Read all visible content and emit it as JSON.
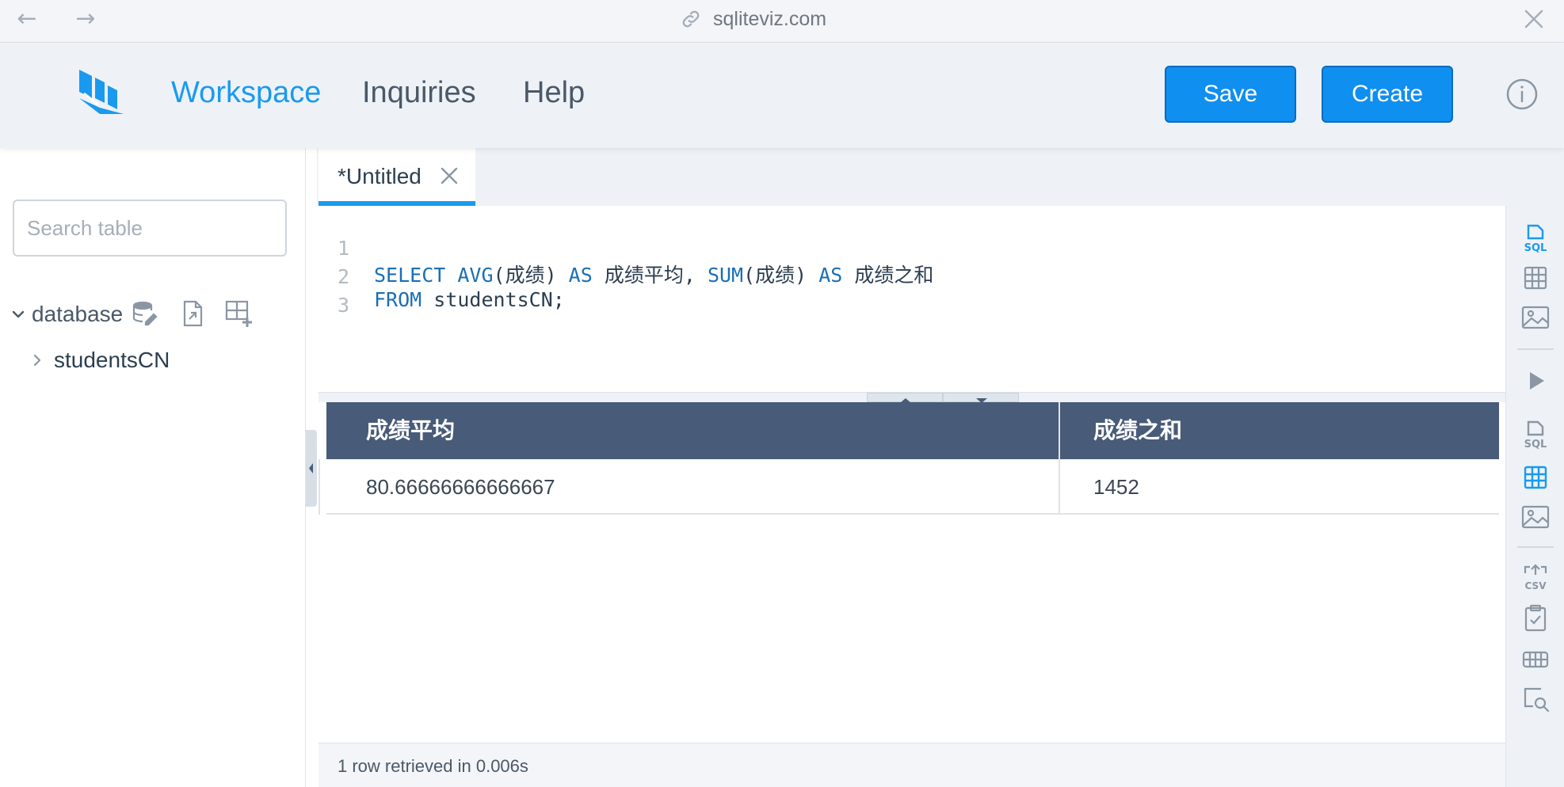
{
  "browser": {
    "url": "sqliteviz.com",
    "icons": [
      "arrow-left-icon",
      "arrow-right-icon",
      "link-icon",
      "close-icon"
    ]
  },
  "header": {
    "nav": {
      "workspace": "Workspace",
      "inquiries": "Inquiries",
      "help": "Help"
    },
    "save_label": "Save",
    "create_label": "Create",
    "accent_color": "#1a9aef",
    "button_color": "#0f8ff0"
  },
  "sidebar": {
    "search_placeholder": "Search table",
    "database_label": "database",
    "tables": [
      "studentsCN"
    ]
  },
  "tabs": [
    {
      "label": "*Untitled"
    }
  ],
  "editor": {
    "lines": [
      {
        "num": "1",
        "parts": [
          [
            "kw",
            "SELECT "
          ],
          [
            "kw",
            "AVG"
          ],
          [
            "tx",
            "(成绩) "
          ],
          [
            "kw",
            "AS"
          ],
          [
            "tx",
            " 成绩平均, "
          ],
          [
            "kw",
            "SUM"
          ],
          [
            "tx",
            "(成绩) "
          ],
          [
            "kw",
            "AS"
          ],
          [
            "tx",
            " 成绩之和"
          ]
        ]
      },
      {
        "num": "2",
        "parts": [
          [
            "kw",
            "FROM"
          ],
          [
            "tx",
            " studentsCN;"
          ]
        ]
      },
      {
        "num": "3",
        "parts": []
      }
    ]
  },
  "results": {
    "columns": [
      "成绩平均",
      "成绩之和"
    ],
    "rows": [
      [
        "80.66666666666667",
        "1452"
      ]
    ],
    "header_color": "#485b78"
  },
  "status": {
    "text": "1 row retrieved in 0.006s"
  }
}
